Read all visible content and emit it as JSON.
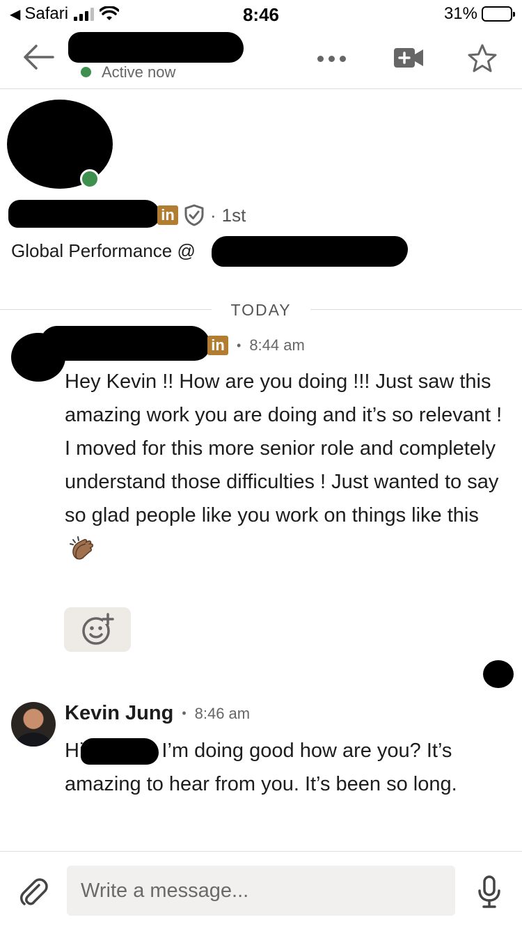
{
  "status_bar": {
    "carrier": "Safari",
    "time": "8:46",
    "battery": "31%"
  },
  "header": {
    "presence": "Active now"
  },
  "profile": {
    "degree": "1st",
    "headline": "Global Performance @"
  },
  "divider": {
    "label": "TODAY"
  },
  "messages": [
    {
      "time": "8:44 am",
      "text": "Hey Kevin !! How are you doing !!! Just saw this amazing work you are doing and it’s so relevant ! I moved for this more senior role and completely understand those difficulties ! Just wanted to say so glad people like you work on things like this"
    },
    {
      "sender": "Kevin Jung",
      "time": "8:46 am",
      "greeting": "Hi",
      "text": "I’m doing good how are you? It’s amazing to hear from you. It’s been so long."
    }
  ],
  "badges": {
    "linkedin": "in"
  },
  "composer": {
    "placeholder": "Write a message..."
  },
  "colors": {
    "presence_green": "#3f8f4f",
    "linkedin_gold": "#b27d31",
    "icon_gray": "#666666",
    "divider": "#dcdcdc"
  },
  "icons": {
    "back": "arrow-left-icon",
    "more": "more-dots-icon",
    "video": "video-call-icon",
    "star": "star-icon",
    "verified": "shield-check-icon",
    "reaction": "add-reaction-icon",
    "attach": "paperclip-icon",
    "mic": "microphone-icon"
  }
}
